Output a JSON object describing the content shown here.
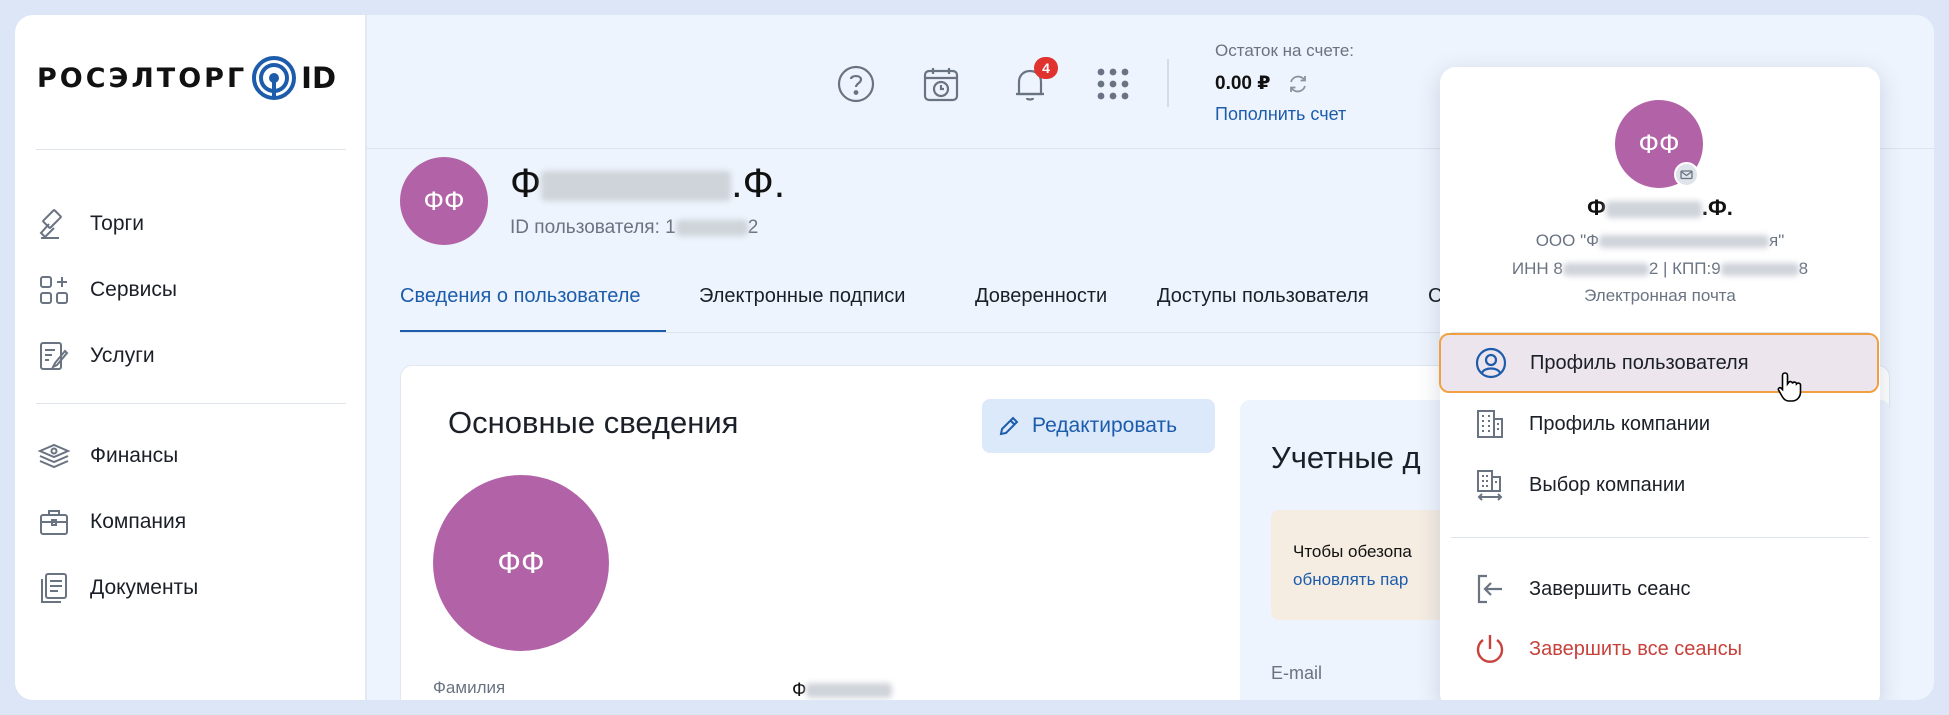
{
  "brand": {
    "name": "РОСЭЛТОРГ",
    "suffix": "ID"
  },
  "sidebar": {
    "items": [
      {
        "label": "Торги",
        "icon": "gavel-icon"
      },
      {
        "label": "Сервисы",
        "icon": "services-grid-icon"
      },
      {
        "label": "Услуги",
        "icon": "document-edit-icon"
      },
      {
        "label": "Финансы",
        "icon": "money-stack-icon"
      },
      {
        "label": "Компания",
        "icon": "briefcase-icon"
      },
      {
        "label": "Документы",
        "icon": "documents-icon"
      }
    ]
  },
  "header": {
    "notifications_count": "4",
    "balance_label": "Остаток на счете:",
    "balance_amount": "0.00 ₽",
    "topup_label": "Пополнить счет"
  },
  "user": {
    "initials": "ФФ",
    "name_prefix": "Ф",
    "name_suffix": ".Ф.",
    "id_label": "ID пользователя: 1",
    "id_end": "2"
  },
  "tabs": [
    {
      "label": "Сведения о пользователе",
      "active": true
    },
    {
      "label": "Электронные подписи",
      "active": false
    },
    {
      "label": "Доверенности",
      "active": false
    },
    {
      "label": "Доступы пользователя",
      "active": false
    },
    {
      "label": "С",
      "active": false
    }
  ],
  "main_card": {
    "title": "Основные сведения",
    "edit_label": "Редактировать",
    "field_label": "Фамилия",
    "field_value_prefix": "Ф"
  },
  "credentials": {
    "title": "Учетные д",
    "warning_line1": "Чтобы обезопа",
    "warning_line2": "обновлять пар",
    "email_label": "E-mail"
  },
  "dropdown": {
    "name_prefix": "Ф",
    "name_suffix": ".Ф.",
    "org_prefix": "ООО \"Ф",
    "org_suffix": "я\"",
    "inn_prefix": "ИНН 8",
    "inn_mid": "2 | КПП:9",
    "inn_end": "8",
    "email_label": "Электронная почта",
    "items": [
      {
        "label": "Профиль пользователя",
        "icon": "user-circle-icon",
        "highlighted": true
      },
      {
        "label": "Профиль компании",
        "icon": "building-icon"
      },
      {
        "label": "Выбор компании",
        "icon": "building-switch-icon"
      },
      {
        "label": "Завершить сеанс",
        "icon": "logout-icon"
      },
      {
        "label": "Завершить все сеансы",
        "icon": "power-icon",
        "danger": true
      }
    ]
  },
  "colors": {
    "accent": "#1c5cab",
    "avatar": "#b263a7",
    "badge": "#e0322f",
    "danger": "#c8413b",
    "highlight_border": "#f0a043"
  }
}
